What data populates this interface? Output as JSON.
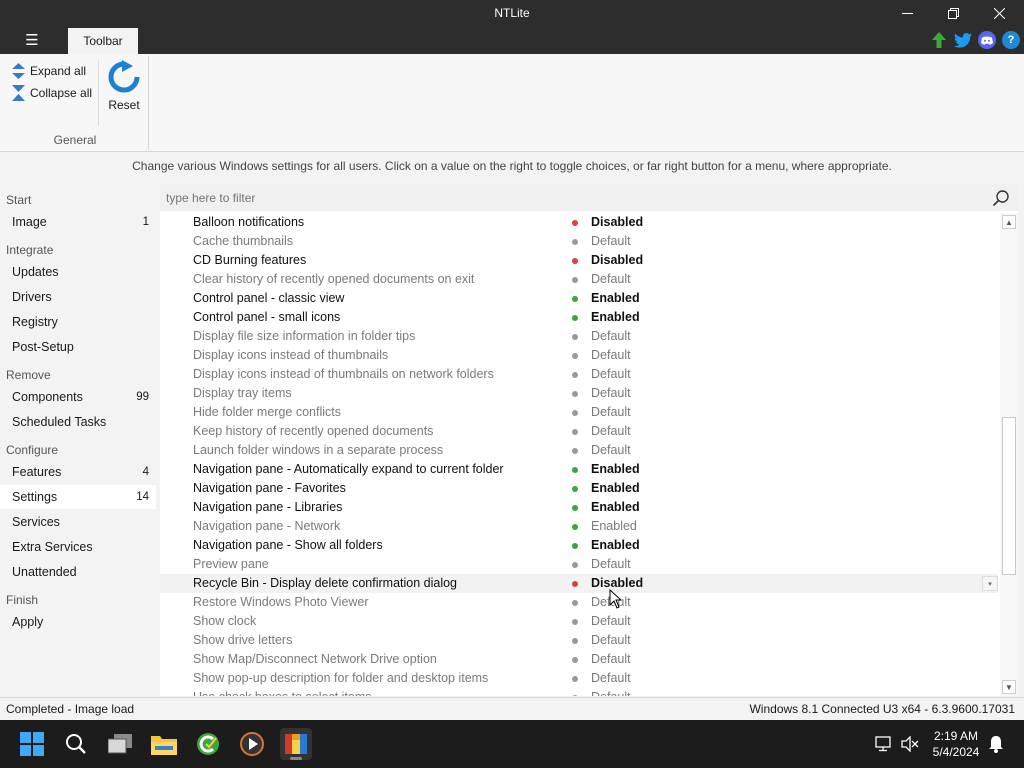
{
  "window": {
    "title": "NTLite"
  },
  "ribbon": {
    "menu_icon": "hamburger-icon",
    "tab_label": "Toolbar",
    "expand_all": "Expand all",
    "collapse_all": "Collapse all",
    "reset": "Reset",
    "group_label": "General"
  },
  "social": {
    "update": "update-arrow-icon",
    "twitter": "twitter-icon",
    "discord": "discord-icon",
    "help": "?"
  },
  "info_text": "Change various Windows settings for all users. Click on a value on the right to toggle choices, or far right button for a menu, where appropriate.",
  "filter": {
    "placeholder": "type here to filter"
  },
  "sidebar": {
    "start_heading": "Start",
    "image": {
      "label": "Image",
      "count": "1"
    },
    "integrate_heading": "Integrate",
    "updates": "Updates",
    "drivers": "Drivers",
    "registry": "Registry",
    "post_setup": "Post-Setup",
    "remove_heading": "Remove",
    "components": {
      "label": "Components",
      "count": "99"
    },
    "scheduled_tasks": "Scheduled Tasks",
    "configure_heading": "Configure",
    "features": {
      "label": "Features",
      "count": "4"
    },
    "settings": {
      "label": "Settings",
      "count": "14"
    },
    "services": "Services",
    "extra_services": "Extra Services",
    "unattended": "Unattended",
    "finish_heading": "Finish",
    "apply": "Apply"
  },
  "colors": {
    "disabled": "#e03c3c",
    "enabled": "#3aa53a",
    "default": "#9a9a9a"
  },
  "settings_rows": [
    {
      "name": "Balloon notifications",
      "value": "Disabled",
      "state": "disabled",
      "style": "bold"
    },
    {
      "name": "Cache thumbnails",
      "value": "Default",
      "state": "default",
      "style": "dim"
    },
    {
      "name": "CD Burning features",
      "value": "Disabled",
      "state": "disabled",
      "style": "bold"
    },
    {
      "name": "Clear history of recently opened documents on exit",
      "value": "Default",
      "state": "default",
      "style": "dim"
    },
    {
      "name": "Control panel - classic view",
      "value": "Enabled",
      "state": "enabled",
      "style": "bold"
    },
    {
      "name": "Control panel - small icons",
      "value": "Enabled",
      "state": "enabled",
      "style": "bold"
    },
    {
      "name": "Display file size information in folder tips",
      "value": "Default",
      "state": "default",
      "style": "dim"
    },
    {
      "name": "Display icons instead of thumbnails",
      "value": "Default",
      "state": "default",
      "style": "dim"
    },
    {
      "name": "Display icons instead of thumbnails on network folders",
      "value": "Default",
      "state": "default",
      "style": "dim"
    },
    {
      "name": "Display tray items",
      "value": "Default",
      "state": "default",
      "style": "dim"
    },
    {
      "name": "Hide folder merge conflicts",
      "value": "Default",
      "state": "default",
      "style": "dim"
    },
    {
      "name": "Keep history of recently opened documents",
      "value": "Default",
      "state": "default",
      "style": "dim"
    },
    {
      "name": "Launch folder windows in a separate process",
      "value": "Default",
      "state": "default",
      "style": "dim"
    },
    {
      "name": "Navigation pane - Automatically expand to current folder",
      "value": "Enabled",
      "state": "enabled",
      "style": "bold"
    },
    {
      "name": "Navigation pane - Favorites",
      "value": "Enabled",
      "state": "enabled",
      "style": "bold"
    },
    {
      "name": "Navigation pane - Libraries",
      "value": "Enabled",
      "state": "enabled",
      "style": "bold"
    },
    {
      "name": "Navigation pane - Network",
      "value": "Enabled",
      "state": "enabled",
      "style": "dim"
    },
    {
      "name": "Navigation pane - Show all folders",
      "value": "Enabled",
      "state": "enabled",
      "style": "bold"
    },
    {
      "name": "Preview pane",
      "value": "Default",
      "state": "default",
      "style": "dim"
    },
    {
      "name": "Recycle Bin - Display delete confirmation dialog",
      "value": "Disabled",
      "state": "disabled",
      "style": "bold",
      "highlight": true
    },
    {
      "name": "Restore Windows Photo Viewer",
      "value": "Default",
      "state": "default",
      "style": "dim"
    },
    {
      "name": "Show clock",
      "value": "Default",
      "state": "default",
      "style": "dim"
    },
    {
      "name": "Show drive letters",
      "value": "Default",
      "state": "default",
      "style": "dim"
    },
    {
      "name": "Show Map/Disconnect Network Drive option",
      "value": "Default",
      "state": "default",
      "style": "dim"
    },
    {
      "name": "Show pop-up description for folder and desktop items",
      "value": "Default",
      "state": "default",
      "style": "dim"
    },
    {
      "name": "Use check boxes to select items",
      "value": "Default",
      "state": "default",
      "style": "dim"
    }
  ],
  "status": {
    "left": "Completed - Image load",
    "right": "Windows 8.1 Connected U3 x64 - 6.3.9600.17031"
  },
  "taskbar": {
    "time": "2:19 AM",
    "date": "5/4/2024"
  }
}
